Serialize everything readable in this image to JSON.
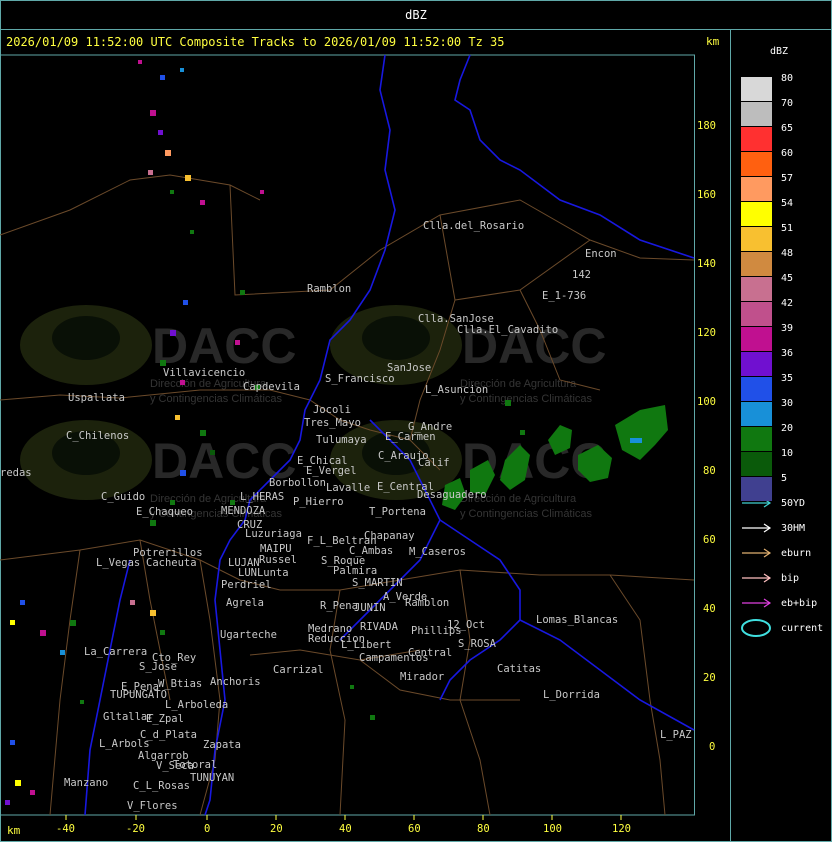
{
  "top_title": "dBZ",
  "header": "2026/01/09 11:52:00 UTC Composite Tracks to 2026/01/09 11:52:00 Tz 35",
  "axis_unit_top": "km",
  "axis_unit_bottom": "km",
  "x_ticks": [
    "-40",
    "-20",
    "0",
    "20",
    "40",
    "60",
    "80",
    "100",
    "120"
  ],
  "y_ticks": [
    "180",
    "160",
    "140",
    "120",
    "100",
    "80",
    "60",
    "40",
    "20",
    "0"
  ],
  "legend": {
    "title": "dBZ",
    "levels": [
      {
        "label": "80",
        "color": "#d8d8d8"
      },
      {
        "label": "70",
        "color": "#bdbdbd"
      },
      {
        "label": "65",
        "color": "#ff3030"
      },
      {
        "label": "60",
        "color": "#ff6010"
      },
      {
        "label": "57",
        "color": "#ff9a60"
      },
      {
        "label": "54",
        "color": "#ffff00"
      },
      {
        "label": "51",
        "color": "#f8c030"
      },
      {
        "label": "48",
        "color": "#d08a40"
      },
      {
        "label": "45",
        "color": "#c87090"
      },
      {
        "label": "42",
        "color": "#c0508c"
      },
      {
        "label": "39",
        "color": "#c01090"
      },
      {
        "label": "36",
        "color": "#7010d0"
      },
      {
        "label": "35",
        "color": "#2050e8"
      },
      {
        "label": "30",
        "color": "#1890d8"
      },
      {
        "label": "20",
        "color": "#107810"
      },
      {
        "label": "10",
        "color": "#0a5a0a"
      },
      {
        "label": "5",
        "color": "#404090"
      }
    ],
    "tracks": [
      {
        "label": "50YD",
        "color": "#40d0d0"
      },
      {
        "label": "30HM",
        "color": "#ffffff"
      },
      {
        "label": "eburn",
        "color": "#e0b070"
      },
      {
        "label": "bip",
        "color": "#ffc0c0"
      },
      {
        "label": "eb+bip",
        "color": "#e040e0"
      },
      {
        "label": "current",
        "color": "#40e0e0"
      }
    ]
  },
  "places": [
    "Clla.del_Rosario",
    "Encon",
    "142",
    "E_1-736",
    "Ramblon",
    "Clla.SanJose",
    "Clla.El_Cavadito",
    "Villavicencio",
    "Capdevila",
    "S_Francisco",
    "SanJose",
    "L_Asuncion",
    "Uspallata",
    "Tres_Mayo",
    "Jocoli",
    "Tulumaya",
    "G_Andre",
    "E_Carmen",
    "C_Chilenos",
    "E_Chical",
    "C_Araujo",
    "Calif",
    "redas",
    "E_Vergel",
    "Borbollon",
    "Lavalle",
    "E_Central",
    "Desaguadero",
    "C_Guido",
    "L_HERAS",
    "P_Hierro",
    "T_Portena",
    "E_Chaqueo",
    "MENDOZA",
    "CRUZ",
    "Luzuriaga",
    "Chapanay",
    "F_L_Beltran",
    "Potrerillos",
    "MAIPU",
    "C_Ambas",
    "M_Caseros",
    "L_Vegas",
    "Cacheuta",
    "LUJAN",
    "Russel",
    "S_Roque",
    "Palmira",
    "LUNLunta",
    "S_MARTIN",
    "Perdriel",
    "A_Verde",
    "Ramblon",
    "Agrela",
    "R_Pena",
    "JUNIN",
    "Lomas_Blancas",
    "Ugarteche",
    "Medrano",
    "RIVADA",
    "Phillips",
    "12_Oct",
    "Reduccion",
    "L_Libert",
    "S_ROSA",
    "La_Carrera",
    "Cto_Rey",
    "S_Jose",
    "Carrizal",
    "Campamentos",
    "Central",
    "Catitas",
    "E_Pena",
    "W_Btias",
    "Anchoris",
    "Mirador",
    "TUPUNGATO",
    "L_Dorrida",
    "E_Zpal",
    "L_Arboleda",
    "Gltallar",
    "C_d_Plata",
    "L_Arbols",
    "Zapata",
    "Algarrob",
    "V_Seca",
    "Totoral",
    "TUNUYAN",
    "Manzano",
    "C_L_Rosas",
    "V_Flores",
    "L_PAZ"
  ],
  "watermark": {
    "brand": "DACC",
    "line1": "Dirección de Agricultura",
    "line2": "y Contingencias Climáticas"
  }
}
